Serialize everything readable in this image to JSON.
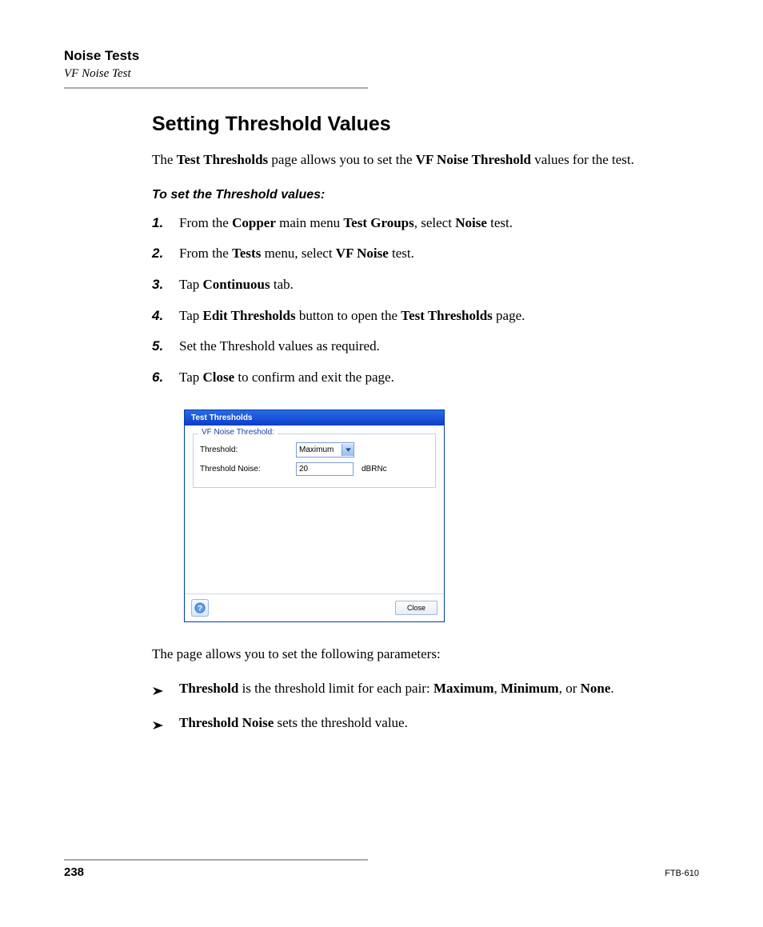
{
  "header": {
    "chapter": "Noise Tests",
    "section": "VF Noise Test"
  },
  "heading": "Setting Threshold Values",
  "intro": {
    "pre": "The ",
    "b1": "Test Thresholds",
    "mid": " page allows you to set the ",
    "b2": "VF Noise Threshold",
    "post": " values for the test."
  },
  "procedure_heading": "To set the Threshold values:",
  "steps": [
    {
      "num": "1.",
      "parts": [
        "From the ",
        "Copper",
        " main menu ",
        "Test Groups",
        ", select ",
        "Noise",
        " test."
      ]
    },
    {
      "num": "2.",
      "parts": [
        "From the ",
        "Tests",
        " menu, select ",
        "VF Noise",
        " test."
      ]
    },
    {
      "num": "3.",
      "parts": [
        "Tap ",
        "Continuous",
        " tab."
      ]
    },
    {
      "num": "4.",
      "parts": [
        "Tap ",
        "Edit Thresholds",
        " button to open the ",
        "Test Thresholds",
        " page."
      ]
    },
    {
      "num": "5.",
      "parts": [
        "Set the Threshold values as required."
      ]
    },
    {
      "num": "6.",
      "parts": [
        "Tap ",
        "Close",
        " to confirm and exit the page."
      ]
    }
  ],
  "dialog": {
    "title": "Test Thresholds",
    "group": "VF Noise Threshold:",
    "threshold_label": "Threshold:",
    "threshold_value": "Maximum",
    "noise_label": "Threshold Noise:",
    "noise_value": "20",
    "noise_unit": "dBRNc",
    "close": "Close"
  },
  "after_dialog": "The page allows you to set the following parameters:",
  "bullets": [
    {
      "parts": [
        "",
        "Threshold",
        " is the threshold limit for each pair: ",
        "Maximum",
        ", ",
        "Minimum",
        ", or ",
        "None",
        "."
      ]
    },
    {
      "parts": [
        "",
        "Threshold Noise",
        " sets the threshold value."
      ]
    }
  ],
  "footer": {
    "page": "238",
    "doc": "FTB-610"
  }
}
